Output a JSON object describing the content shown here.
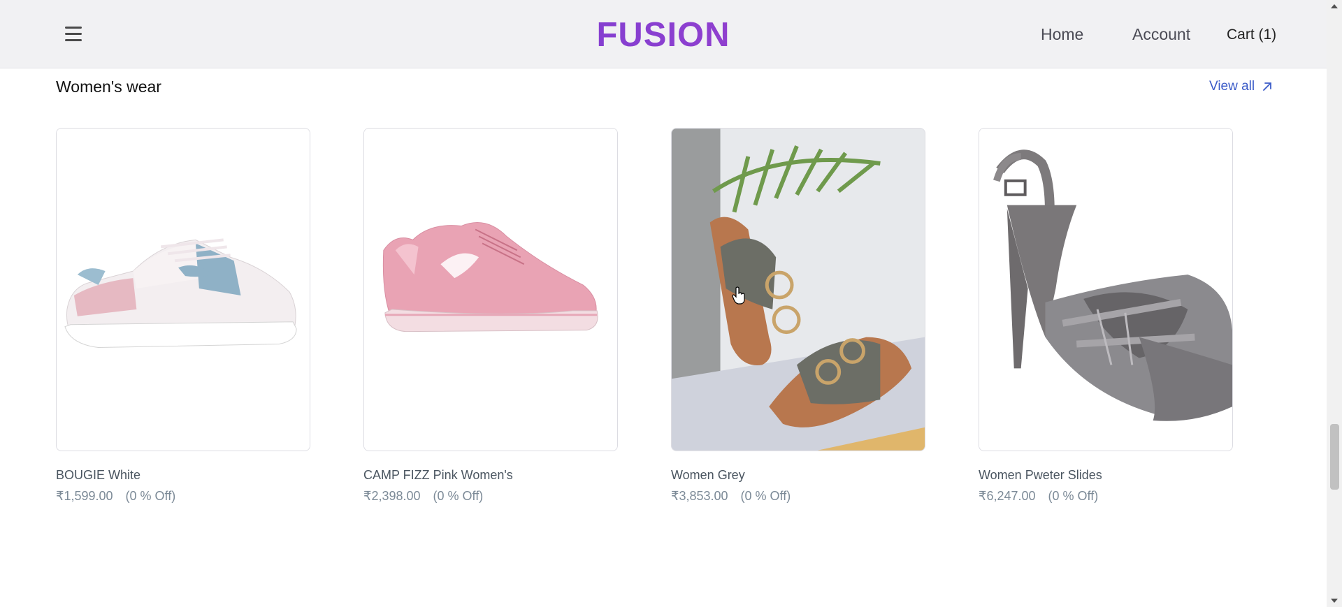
{
  "header": {
    "logo": "FUSION",
    "nav": {
      "home": "Home",
      "account": "Account",
      "cart": "Cart (1)"
    }
  },
  "section": {
    "title": "Women's wear",
    "view_all": "View all"
  },
  "products": [
    {
      "name": "BOUGIE White",
      "price": "₹1,599.00",
      "discount": "(0 % Off)",
      "image": "white-pink-sneaker"
    },
    {
      "name": "CAMP FIZZ Pink Women's",
      "price": "₹2,398.00",
      "discount": "(0 % Off)",
      "image": "pink-running-shoe"
    },
    {
      "name": "Women Grey",
      "price": "₹3,853.00",
      "discount": "(0 % Off)",
      "image": "grey-buckle-slides"
    },
    {
      "name": "Women Pweter Slides",
      "price": "₹6,247.00",
      "discount": "(0 % Off)",
      "image": "pewter-glitter-heel"
    }
  ],
  "colors": {
    "logo_start": "#5b3bd6",
    "logo_end": "#c43fbf",
    "link": "#3b5bc8",
    "price": "#7c8a97"
  },
  "icons": {
    "menu": "hamburger-icon",
    "view_all": "arrow-up-right-icon"
  }
}
